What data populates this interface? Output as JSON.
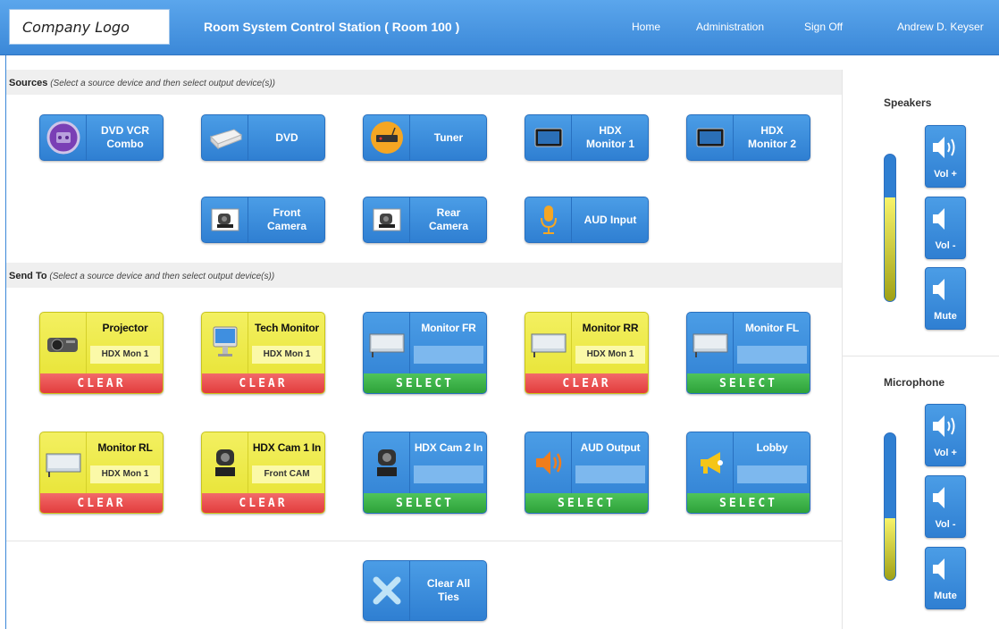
{
  "header": {
    "logo": "Company Logo",
    "title": "Room System Control Station ( Room 100 )",
    "nav": {
      "home": "Home",
      "administration": "Administration",
      "sign_off": "Sign Off",
      "user": "Andrew D. Keyser"
    }
  },
  "sources_section": {
    "title": "Sources",
    "hint": "(Select a source device and then select output device(s))",
    "items": [
      {
        "label": "DVD VCR\nCombo",
        "icon": "dvd-vcr-icon"
      },
      {
        "label": "DVD",
        "icon": "dvd-player-icon"
      },
      {
        "label": "Tuner",
        "icon": "tuner-icon"
      },
      {
        "label": "HDX\nMonitor 1",
        "icon": "monitor-icon"
      },
      {
        "label": "HDX\nMonitor 2",
        "icon": "monitor-icon"
      },
      {
        "label": "Front\nCamera",
        "icon": "camera-icon"
      },
      {
        "label": "Rear\nCamera",
        "icon": "camera-icon"
      },
      {
        "label": "AUD Input",
        "icon": "microphone-icon"
      }
    ]
  },
  "send_section": {
    "title": "Send To",
    "hint": "(Select a source device and then select output device(s))",
    "items": [
      {
        "name": "Projector",
        "tie": "HDX Mon 1",
        "action": "CLEAR",
        "state": "tied",
        "icon": "projector-icon"
      },
      {
        "name": "Tech Monitor",
        "tie": "HDX Mon 1",
        "action": "CLEAR",
        "state": "tied",
        "icon": "desktop-monitor-icon"
      },
      {
        "name": "Monitor FR",
        "tie": "",
        "action": "SELECT",
        "state": "free",
        "icon": "wall-monitor-icon"
      },
      {
        "name": "Monitor RR",
        "tie": "HDX Mon 1",
        "action": "CLEAR",
        "state": "tied",
        "icon": "wall-monitor-icon"
      },
      {
        "name": "Monitor FL",
        "tie": "",
        "action": "SELECT",
        "state": "free",
        "icon": "wall-monitor-icon"
      },
      {
        "name": "Monitor RL",
        "tie": "HDX Mon 1",
        "action": "CLEAR",
        "state": "tied",
        "icon": "wall-monitor-icon"
      },
      {
        "name": "HDX Cam 1 In",
        "tie": "Front CAM",
        "action": "CLEAR",
        "state": "tied",
        "icon": "camera-icon"
      },
      {
        "name": "HDX Cam 2 In",
        "tie": "",
        "action": "SELECT",
        "state": "free",
        "icon": "camera-icon"
      },
      {
        "name": "AUD Output",
        "tie": "",
        "action": "SELECT",
        "state": "free",
        "icon": "speaker-icon"
      },
      {
        "name": "Lobby",
        "tie": "",
        "action": "SELECT",
        "state": "free",
        "icon": "megaphone-icon"
      }
    ]
  },
  "clear_all": {
    "label": "Clear All\nTies",
    "icon": "x-icon"
  },
  "speakers": {
    "title": "Speakers",
    "level": 0.71,
    "vol_up": "Vol +",
    "vol_down": "Vol -",
    "mute": "Mute"
  },
  "microphone": {
    "title": "Microphone",
    "level": 0.42,
    "vol_up": "Vol +",
    "vol_down": "Vol -",
    "mute": "Mute"
  },
  "colors": {
    "accent": "#3b88d8",
    "tied": "#e6e22f",
    "clear": "#e23c3c",
    "select": "#2ea23a",
    "meter": "#f7f36a"
  }
}
